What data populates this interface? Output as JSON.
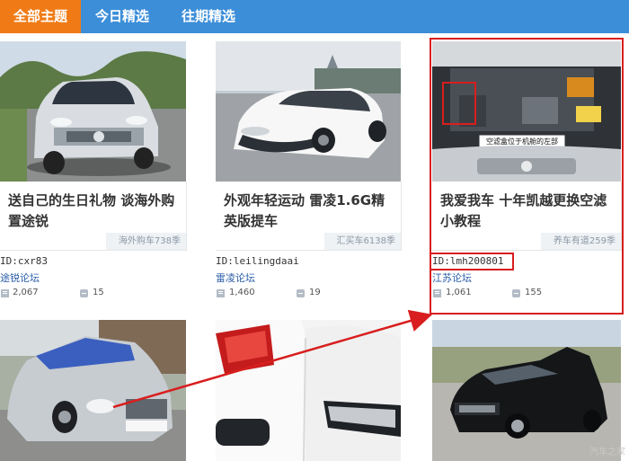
{
  "nav": {
    "tabs": [
      "全部主题",
      "今日精选",
      "往期精选"
    ],
    "active": 0
  },
  "colors": {
    "nav": "#3c8ed8",
    "active_tab": "#f07b16",
    "highlight": "#d81e1e",
    "forum": "#2a5da8"
  },
  "cards": [
    {
      "title": "送自己的生日礼物 谈海外购置途锐",
      "source": "海外购车738季",
      "user_id": "ID:cxr83",
      "forum": "途锐论坛",
      "views": "2,067",
      "replies": "15"
    },
    {
      "title": "外观年轻运动 雷凌1.6G精英版提车",
      "source": "汇买车6138季",
      "user_id": "ID:leilingdaai",
      "forum": "雷凌论坛",
      "views": "1,460",
      "replies": "19"
    },
    {
      "title": "我爱我车 十年凯越更换空滤小教程",
      "source": "养车有道259季",
      "user_id": "ID:lmh200801",
      "forum": "江苏论坛",
      "views": "1,061",
      "replies": "155"
    }
  ],
  "engine_label": "空滤盒位于机舱的左部",
  "watermark": "汽车之家",
  "icons": [
    "views-icon",
    "replies-icon"
  ]
}
